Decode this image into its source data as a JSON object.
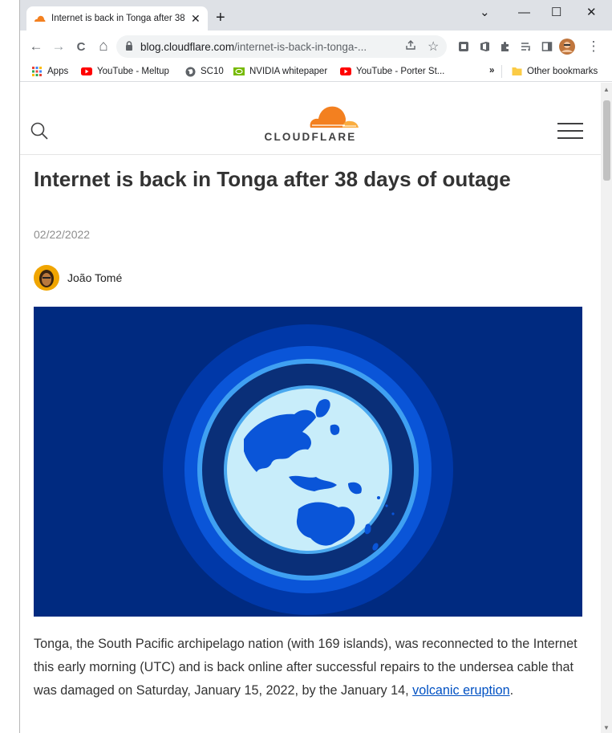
{
  "tab": {
    "title": "Internet is back in Tonga after 38 days of outage"
  },
  "window_controls": {
    "tab_search": "⌄",
    "minimize": "—",
    "maximize": "☐",
    "close": "✕"
  },
  "new_tab": "+",
  "toolbar": {
    "back": "←",
    "forward": "→",
    "reload": "C",
    "home": "⌂",
    "url_host": "blog.cloudflare.com",
    "url_path": "/internet-is-back-in-tonga-...",
    "menu": "⋮"
  },
  "bookmarks": {
    "items": [
      {
        "label": "Apps",
        "icon": "apps-grid-icon"
      },
      {
        "label": "YouTube - Meltup",
        "icon": "youtube-icon"
      },
      {
        "label": "SC10",
        "icon": "globe-icon"
      },
      {
        "label": "NVIDIA whitepaper",
        "icon": "nvidia-icon"
      },
      {
        "label": "YouTube - Porter St...",
        "icon": "youtube-icon"
      }
    ],
    "overflow": "»",
    "other": "Other bookmarks"
  },
  "site": {
    "logo_text": "CLOUDFLARE"
  },
  "article": {
    "title": "Internet is back in Tonga after 38 days of outage",
    "date": "02/22/2022",
    "author": "João Tomé",
    "paragraph_start": "Tonga, the South Pacific archipelago nation (with 169 islands), was reconnected to the Internet this early morning (UTC) and is back online after successful repairs to the undersea cable that was damaged on Saturday, January 15, 2022, by the January 14, ",
    "paragraph_link": "volcanic eruption",
    "paragraph_end": "."
  },
  "colors": {
    "brand_orange": "#f38020",
    "hero_bg": "#002a80",
    "link": "#0051c3"
  }
}
